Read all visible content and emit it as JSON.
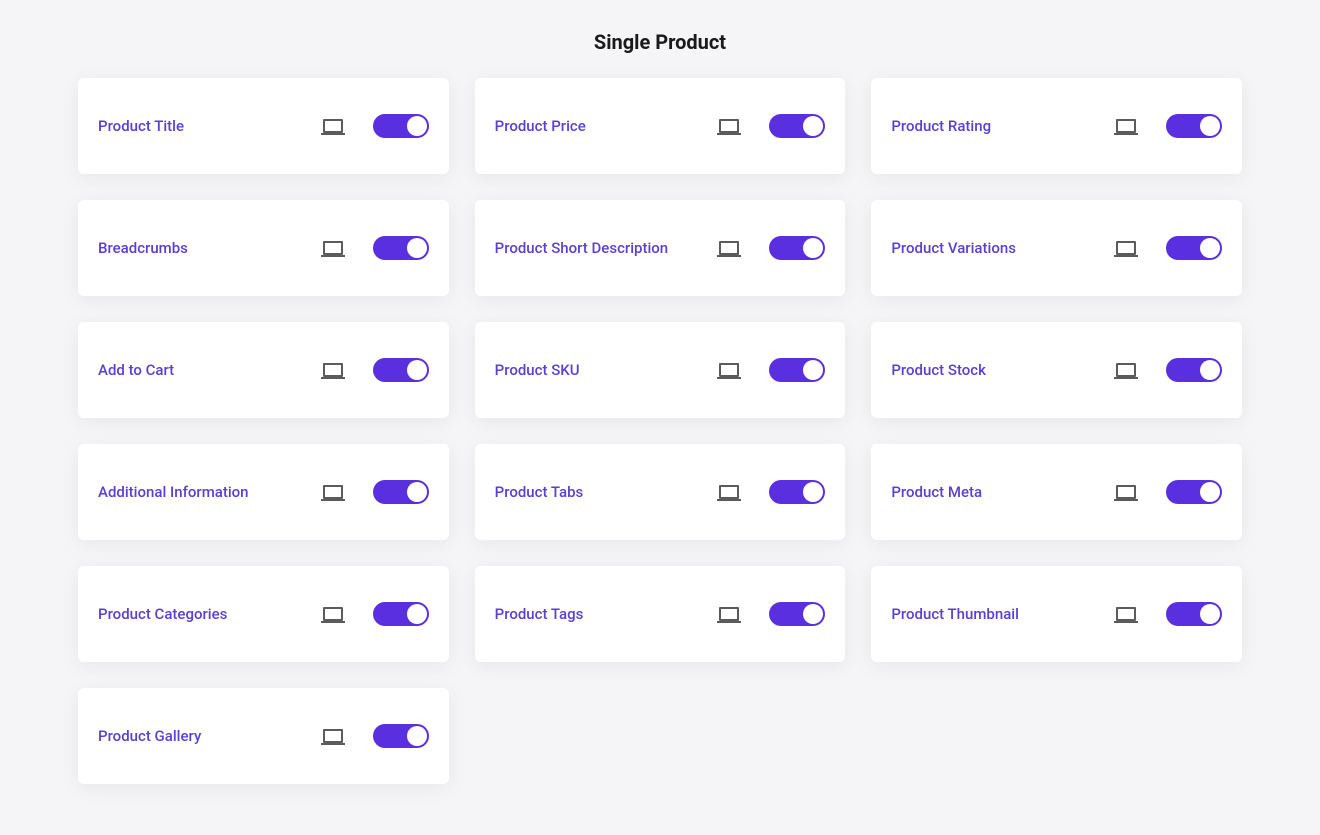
{
  "section_title": "Single Product",
  "cards": [
    {
      "label": "Product Title",
      "on": true
    },
    {
      "label": "Product Price",
      "on": true
    },
    {
      "label": "Product Rating",
      "on": true
    },
    {
      "label": "Breadcrumbs",
      "on": true
    },
    {
      "label": "Product Short Description",
      "on": true
    },
    {
      "label": "Product Variations",
      "on": true
    },
    {
      "label": "Add to Cart",
      "on": true
    },
    {
      "label": "Product SKU",
      "on": true
    },
    {
      "label": "Product Stock",
      "on": true
    },
    {
      "label": "Additional Information",
      "on": true
    },
    {
      "label": "Product Tabs",
      "on": true
    },
    {
      "label": "Product Meta",
      "on": true
    },
    {
      "label": "Product Categories",
      "on": true
    },
    {
      "label": "Product Tags",
      "on": true
    },
    {
      "label": "Product Thumbnail",
      "on": true
    },
    {
      "label": "Product Gallery",
      "on": true
    }
  ]
}
